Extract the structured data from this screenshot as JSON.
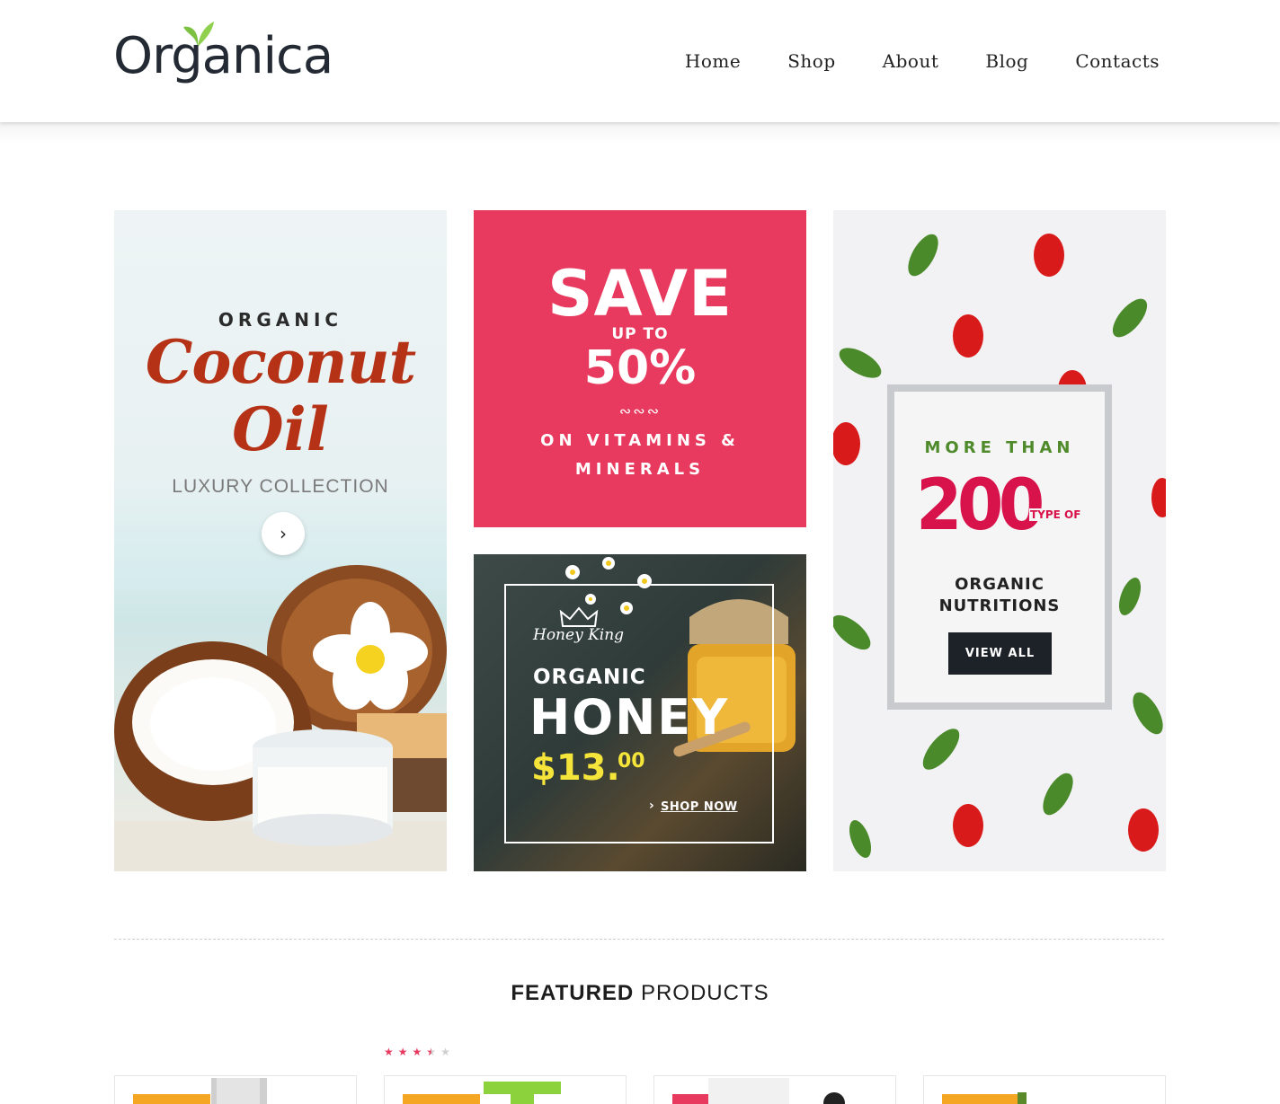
{
  "brand": {
    "logo_text": "Organica"
  },
  "nav": {
    "items": [
      "Home",
      "Shop",
      "About",
      "Blog",
      "Contacts"
    ],
    "active": "Home"
  },
  "banners": {
    "coconut": {
      "kicker": "ORGANIC",
      "title_line1": "Coconut",
      "title_line2": "Oil",
      "subtitle": "LUXURY COLLECTION",
      "arrow_icon": "chevron-right-icon"
    },
    "save": {
      "headline": "SAVE",
      "up_to": "UP TO",
      "percent": "50%",
      "line1": "ON VITAMINS &",
      "line2": "MINERALS",
      "color": "#e83a5f"
    },
    "honey": {
      "brand": "Honey King",
      "kicker": "ORGANIC",
      "title": "HONEY",
      "price": "$13.",
      "cents": "00",
      "cta": "SHOP NOW"
    },
    "nutrition": {
      "kicker": "MORE THAN",
      "number": "200",
      "type_of": "TYPE OF",
      "line1": "ORGANIC",
      "line2": "NUTRITIONS",
      "cta": "VIEW ALL"
    }
  },
  "featured": {
    "bold": "FEATURED",
    "rest": "PRODUCTS"
  },
  "rating": {
    "value": 3.5,
    "max": 5
  },
  "colors": {
    "accent_green": "#7cc142",
    "pink": "#e83a5f",
    "badge_orange": "#f5a623",
    "crimson": "#d8124a"
  }
}
